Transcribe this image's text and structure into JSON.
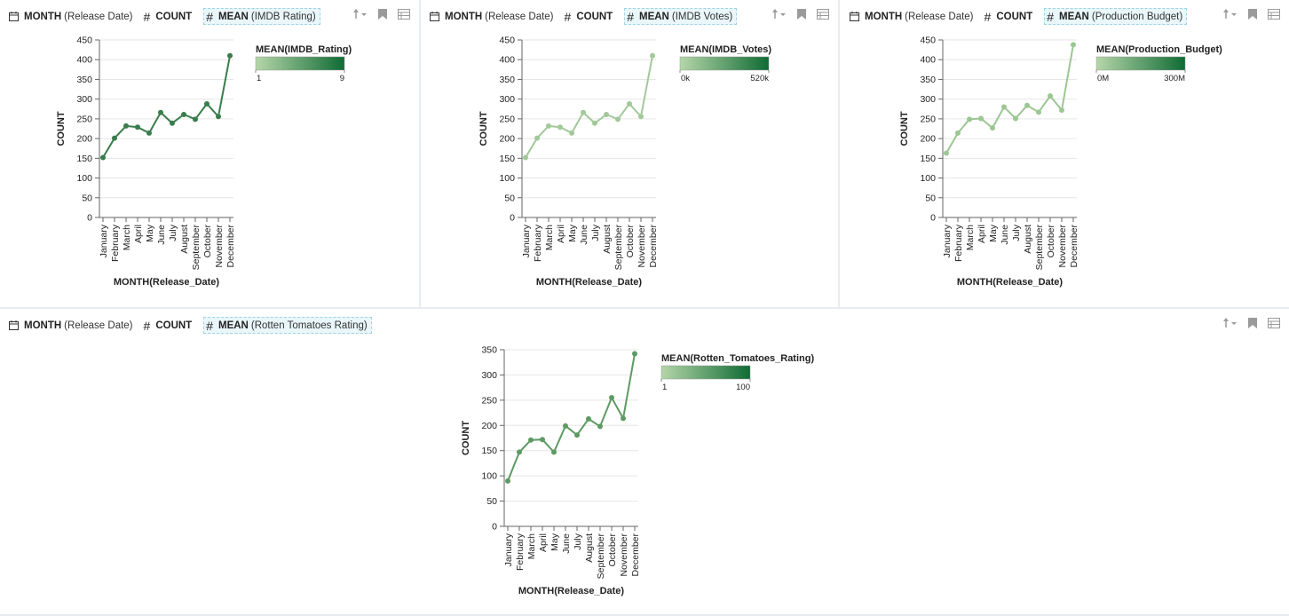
{
  "header_parts": {
    "month_bold": "MONTH",
    "month_sub": "(Release Date)",
    "count": "COUNT",
    "mean_bold": "MEAN"
  },
  "icons": {
    "calendar": "calendar-icon",
    "hash": "hash-icon",
    "sort": "sort-icon",
    "bookmark": "bookmark-icon",
    "table": "table-icon"
  },
  "colors": {
    "line_dark": "#3a7d4c",
    "line_light": "#a3c89a",
    "grid": "#e6e6e6",
    "legend_low": "#b5d6a9",
    "legend_high": "#0f6b34",
    "highlight_bg": "#e9f6fa"
  },
  "panels": [
    {
      "mean_sub": "(IMDB Rating)",
      "chart_data": {
        "type": "line",
        "xlabel": "MONTH(Release_Date)",
        "ylabel": "COUNT",
        "categories": [
          "January",
          "February",
          "March",
          "April",
          "May",
          "June",
          "July",
          "August",
          "September",
          "October",
          "November",
          "December"
        ],
        "values": [
          152,
          201,
          232,
          229,
          214,
          266,
          239,
          261,
          249,
          288,
          256,
          410
        ],
        "ylim": [
          0,
          450
        ],
        "yticks": [
          "0",
          "50",
          "100",
          "150",
          "200",
          "250",
          "300",
          "350",
          "400",
          "450"
        ],
        "color": "#3a7d4c",
        "legend": {
          "title": "MEAN(IMDB_Rating)",
          "min": "1",
          "max": "9"
        }
      }
    },
    {
      "mean_sub": "(IMDB Votes)",
      "chart_data": {
        "type": "line",
        "xlabel": "MONTH(Release_Date)",
        "ylabel": "COUNT",
        "categories": [
          "January",
          "February",
          "March",
          "April",
          "May",
          "June",
          "July",
          "August",
          "September",
          "October",
          "November",
          "December"
        ],
        "values": [
          152,
          201,
          232,
          229,
          214,
          266,
          239,
          261,
          249,
          288,
          256,
          410
        ],
        "ylim": [
          0,
          450
        ],
        "yticks": [
          "0",
          "50",
          "100",
          "150",
          "200",
          "250",
          "300",
          "350",
          "400",
          "450"
        ],
        "color": "#a3c89a",
        "legend": {
          "title": "MEAN(IMDB_Votes)",
          "min": "0k",
          "max": "520k"
        }
      }
    },
    {
      "mean_sub": "(Production Budget)",
      "chart_data": {
        "type": "line",
        "xlabel": "MONTH(Release_Date)",
        "ylabel": "COUNT",
        "categories": [
          "January",
          "February",
          "March",
          "April",
          "May",
          "June",
          "July",
          "August",
          "September",
          "October",
          "November",
          "December"
        ],
        "values": [
          163,
          214,
          249,
          251,
          227,
          280,
          251,
          284,
          267,
          308,
          272,
          438
        ],
        "ylim": [
          0,
          450
        ],
        "yticks": [
          "0",
          "50",
          "100",
          "150",
          "200",
          "250",
          "300",
          "350",
          "400",
          "450"
        ],
        "color": "#9cc693",
        "legend": {
          "title": "MEAN(Production_Budget)",
          "min": "0M",
          "max": "300M"
        }
      }
    },
    {
      "mean_sub": "(Rotten Tomatoes Rating)",
      "chart_data": {
        "type": "line",
        "xlabel": "MONTH(Release_Date)",
        "ylabel": "COUNT",
        "categories": [
          "January",
          "February",
          "March",
          "April",
          "May",
          "June",
          "July",
          "August",
          "September",
          "October",
          "November",
          "December"
        ],
        "values": [
          90,
          147,
          171,
          172,
          147,
          199,
          181,
          213,
          198,
          255,
          214,
          342
        ],
        "ylim": [
          0,
          350
        ],
        "yticks": [
          "0",
          "50",
          "100",
          "150",
          "200",
          "250",
          "300",
          "350"
        ],
        "color": "#5e9a63",
        "legend": {
          "title": "MEAN(Rotten_Tomatoes_Rating)",
          "min": "1",
          "max": "100"
        }
      }
    }
  ]
}
